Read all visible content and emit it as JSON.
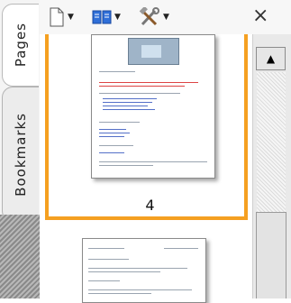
{
  "tabs": {
    "pages_label": "Pages",
    "bookmarks_label": "Bookmarks"
  },
  "toolbar": {
    "new_icon": "page-icon",
    "book_icon": "book-icon",
    "tools_icon": "tools-icon",
    "close_label": "×"
  },
  "thumbnails": {
    "selected_page_number": "4"
  },
  "scrollbar": {
    "up_arrow": "▲"
  },
  "colors": {
    "selection": "#f5a021",
    "accent_blue": "#1f5fc9"
  }
}
